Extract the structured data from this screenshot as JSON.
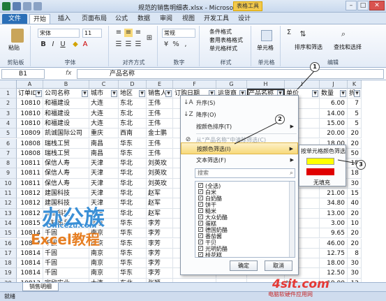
{
  "window": {
    "title": "规范的销售明细表.xlsx - Microsoft Excel",
    "context_tab": "表格工具"
  },
  "tabs": [
    "文件",
    "开始",
    "插入",
    "页面布局",
    "公式",
    "数据",
    "审阅",
    "视图",
    "开发工具",
    "设计"
  ],
  "ribbon": {
    "groups": [
      "剪贴板",
      "字体",
      "对齐方式",
      "数字",
      "样式",
      "单元格",
      "编辑"
    ],
    "font_name": "宋体",
    "font_size": "11",
    "number_format": "常规",
    "paste": "粘贴",
    "styles": [
      "条件格式",
      "套用表格格式",
      "单元格样式"
    ],
    "cells": "单元格",
    "sort_filter": "排序和筛选",
    "find_select": "查找和选择"
  },
  "formula_bar": {
    "name_box": "B1",
    "fx": "fx",
    "value": "产品名称"
  },
  "columns": [
    "A",
    "B",
    "C",
    "D",
    "E",
    "F",
    "G",
    "H",
    "I",
    "J",
    "K"
  ],
  "headers": [
    "订单ID",
    "公司名称",
    "城市",
    "地区",
    "销售人",
    "订购日期",
    "运货商",
    "产品名称",
    "单价",
    "数量",
    "折"
  ],
  "rows": [
    [
      "10810",
      "和福建设",
      "大连",
      "东北",
      "王伟",
      "",
      "",
      "",
      "¥",
      "6.00",
      "7"
    ],
    [
      "10810",
      "和福建设",
      "大连",
      "东北",
      "王伟",
      "",
      "",
      "",
      "¥",
      "14.00",
      "5"
    ],
    [
      "10810",
      "和福建设",
      "大连",
      "东北",
      "王伟",
      "",
      "",
      "",
      "¥",
      "15.00",
      "5"
    ],
    [
      "10809",
      "凯诚国际公司",
      "重庆",
      "西南",
      "金士鹏",
      "",
      "",
      "",
      "¥",
      "20.00",
      "20"
    ],
    [
      "10808",
      "瑞栈工贸",
      "南昌",
      "华东",
      "王伟",
      "",
      "",
      "",
      "¥",
      "18.00",
      "20"
    ],
    [
      "10808",
      "瑞栈工贸",
      "南昌",
      "华东",
      "王伟",
      "",
      "",
      "",
      "¥",
      "18.00",
      "50"
    ],
    [
      "10811",
      "保信人寿",
      "天津",
      "华北",
      "刘英玫",
      "",
      "",
      "",
      "¥",
      "7.00",
      "15"
    ],
    [
      "10811",
      "保信人寿",
      "天津",
      "华北",
      "刘英玫",
      "",
      "",
      "",
      "¥",
      "15.00",
      "18"
    ],
    [
      "10811",
      "保信人寿",
      "天津",
      "华北",
      "刘英玫",
      "",
      "",
      "",
      "¥",
      "34.00",
      "30"
    ],
    [
      "10812",
      "建国科技",
      "天津",
      "华北",
      "赵军",
      "",
      "",
      "",
      "¥",
      "21.00",
      "15"
    ],
    [
      "10812",
      "建国科技",
      "天津",
      "华北",
      "赵军",
      "",
      "",
      "",
      "¥",
      "34.80",
      "40"
    ],
    [
      "10812",
      "建国科技",
      "天津",
      "华北",
      "赵军",
      "",
      "",
      "",
      "¥",
      "13.00",
      "20"
    ],
    [
      "10815",
      "大钰贸易",
      "南京",
      "华东",
      "李芳",
      "",
      "",
      "",
      "¥",
      "3.00",
      "10"
    ],
    [
      "10814",
      "千固",
      "南京",
      "华东",
      "李芳",
      "",
      "",
      "",
      "¥",
      "9.65",
      "20"
    ],
    [
      "10814",
      "千固",
      "南京",
      "华东",
      "李芳",
      "",
      "",
      "",
      "¥",
      "46.00",
      "20"
    ],
    [
      "10814",
      "千固",
      "南京",
      "华东",
      "李芳",
      "",
      "",
      "",
      "¥",
      "12.75",
      "8"
    ],
    [
      "10814",
      "千固",
      "南京",
      "华东",
      "李芳",
      "",
      "",
      "",
      "¥",
      "18.00",
      "30"
    ],
    [
      "10814",
      "千固",
      "南京",
      "华东",
      "李芳",
      "",
      "",
      "",
      "¥",
      "12.50",
      "30"
    ],
    [
      "10813",
      "宇欣实业",
      "大连",
      "东北",
      "张颖",
      "",
      "",
      "",
      "¥",
      "19.00",
      "12"
    ],
    [
      "10813",
      "宇欣实业",
      "大连",
      "东北",
      "张颖",
      "",
      "",
      "",
      "¥",
      "",
      "35"
    ]
  ],
  "menu": {
    "items": [
      "升序(S)",
      "降序(O)",
      "按颜色排序(T)",
      "从“产品名称”中清除筛选(C)",
      "按颜色筛选(I)",
      "文本筛选(F)"
    ],
    "search_placeholder": "搜索",
    "list": [
      {
        "label": "(全选)",
        "checked": true
      },
      {
        "label": "白米",
        "checked": true
      },
      {
        "label": "白奶酪",
        "checked": true
      },
      {
        "label": "饼干",
        "checked": true
      },
      {
        "label": "糙米",
        "checked": true
      },
      {
        "label": "大众奶酪",
        "checked": true
      },
      {
        "label": "蛋糕",
        "checked": true
      },
      {
        "label": "德国奶酪",
        "checked": true
      },
      {
        "label": "番茄酱",
        "checked": true
      },
      {
        "label": "干贝",
        "checked": true
      },
      {
        "label": "光明奶酪",
        "checked": true
      },
      {
        "label": "桂花糕",
        "checked": true
      }
    ],
    "ok": "确定",
    "cancel": "取消"
  },
  "submenu": {
    "title": "按单元格颜色筛选",
    "colors": [
      "#ffff00",
      "#e00000"
    ],
    "none": "无填充"
  },
  "sheet_tab": "销售明细",
  "status": "就绪",
  "callouts": [
    "1",
    "2",
    "3"
  ],
  "watermarks": [
    "办公族",
    "Officezu.com",
    "Excel教程",
    "4sit.com",
    "电脑软硬件应用网"
  ],
  "colors": {
    "accent": "#2b6fb7",
    "highlight": "#f7d97a"
  }
}
